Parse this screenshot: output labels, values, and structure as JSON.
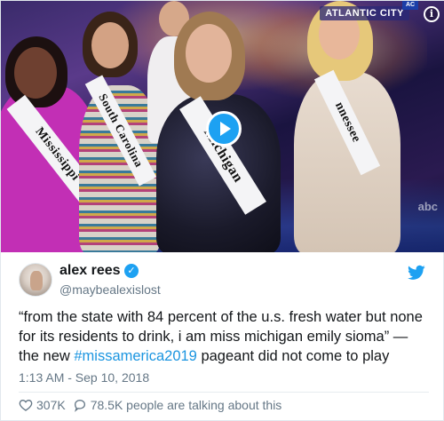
{
  "media": {
    "network_label": "ATLANTIC CITY",
    "network_badge": "AC",
    "info_glyph": "i",
    "watermark": "abc",
    "sashes": {
      "left": "Mississippi",
      "center_left": "South Carolina",
      "center": "Michigan",
      "right": "nnessee"
    },
    "icons": [
      "info-icon",
      "play-icon"
    ],
    "accent_color": "#1da1f2"
  },
  "tweet": {
    "author_name": "alex rees",
    "handle": "@maybealexislost",
    "text_before": "“from the state with 84 percent of the u.s. fresh water but none for its residents to drink, i am miss michigan emily sioma” — the new ",
    "hashtag": "#missamerica2019",
    "text_after": " pageant did not come to play",
    "timestamp": "1:13 AM - Sep 10, 2018",
    "likes": "307K",
    "talking": "78.5K people are talking about this",
    "icons": [
      "verified-icon",
      "twitter-bird-icon",
      "heart-icon",
      "reply-bubble-icon"
    ],
    "link_color": "#1b95e0",
    "secondary_color": "#657786"
  }
}
